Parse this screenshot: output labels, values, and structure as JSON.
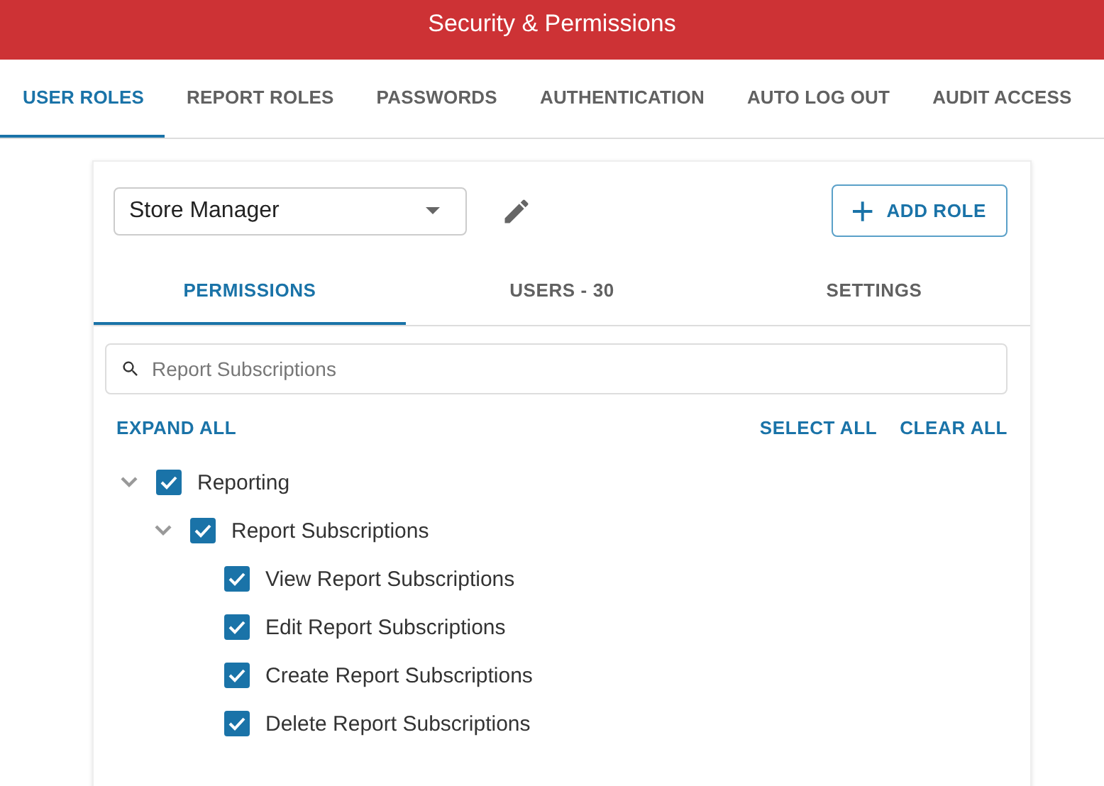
{
  "header": {
    "title": "Security & Permissions"
  },
  "tabs": [
    {
      "label": "USER ROLES",
      "selected": true
    },
    {
      "label": "REPORT ROLES",
      "selected": false
    },
    {
      "label": "PASSWORDS",
      "selected": false
    },
    {
      "label": "AUTHENTICATION",
      "selected": false
    },
    {
      "label": "AUTO LOG OUT",
      "selected": false
    },
    {
      "label": "AUDIT ACCESS",
      "selected": false
    }
  ],
  "role_select": {
    "value": "Store Manager"
  },
  "add_button": {
    "label": "ADD ROLE"
  },
  "sub_tabs": [
    {
      "label": "PERMISSIONS",
      "selected": true
    },
    {
      "label": "USERS - 30",
      "selected": false
    },
    {
      "label": "SETTINGS",
      "selected": false
    }
  ],
  "search": {
    "value": "Report Subscriptions"
  },
  "actions": {
    "expand_all": "EXPAND ALL",
    "select_all": "SELECT ALL",
    "clear_all": "CLEAR ALL"
  },
  "tree": [
    {
      "label": "Reporting",
      "checked": true,
      "expanded": true,
      "children": [
        {
          "label": "Report Subscriptions",
          "checked": true,
          "expanded": true,
          "children": [
            {
              "label": "View Report Subscriptions",
              "checked": true
            },
            {
              "label": "Edit Report Subscriptions",
              "checked": true
            },
            {
              "label": "Create Report Subscriptions",
              "checked": true
            },
            {
              "label": "Delete Report Subscriptions",
              "checked": true
            }
          ]
        }
      ]
    }
  ]
}
